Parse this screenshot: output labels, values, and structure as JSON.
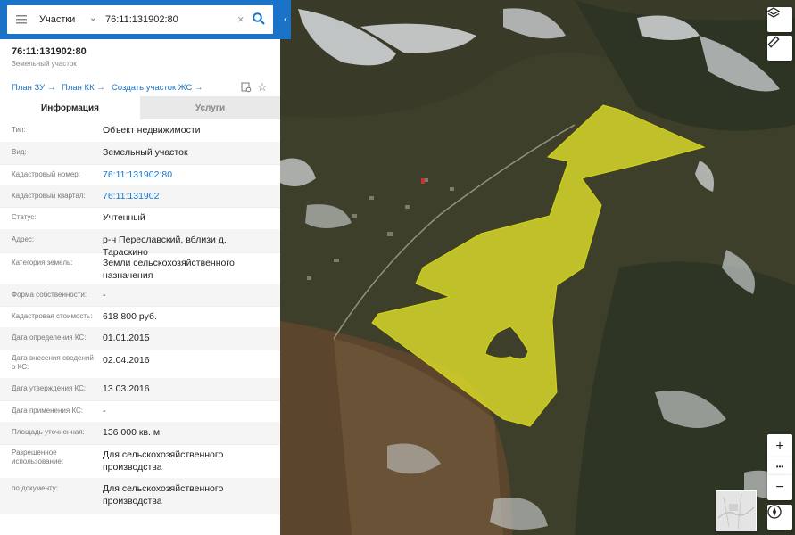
{
  "search": {
    "category": "Участки",
    "query": "76:11:131902:80"
  },
  "header": {
    "title": "76:11:131902:80",
    "subtitle": "Земельный участок"
  },
  "actions": {
    "plan_zu": "План ЗУ →",
    "plan_kk": "План КК →",
    "create": "Создать участок ЖС →"
  },
  "tabs": [
    {
      "label": "Информация",
      "active": true
    },
    {
      "label": "Услуги",
      "active": false
    }
  ],
  "info": [
    {
      "key": "Тип:",
      "value": "Объект недвижимости"
    },
    {
      "key": "Вид:",
      "value": "Земельный участок"
    },
    {
      "key": "Кадастровый номер:",
      "value": "76:11:131902:80",
      "link": true
    },
    {
      "key": "Кадастровый квартал:",
      "value": "76:11:131902",
      "link": true
    },
    {
      "key": "Статус:",
      "value": "Учтенный"
    },
    {
      "key": "Адрес:",
      "value": "р-н Переславский, вблизи д. Тараскино"
    },
    {
      "key": "Категория земель:",
      "value": "Земли сельскохозяйственного назначения"
    },
    {
      "key": "Форма собственности:",
      "value": "-"
    },
    {
      "key": "Кадастровая стоимость:",
      "value": "618 800 руб."
    },
    {
      "key": "Дата определения КС:",
      "value": "01.01.2015"
    },
    {
      "key": "Дата внесения сведений о КС:",
      "value": "02.04.2016"
    },
    {
      "key": "Дата утверждения КС:",
      "value": "13.03.2016"
    },
    {
      "key": "Дата применения КС:",
      "value": "-"
    },
    {
      "key": "Площадь уточненная:",
      "value": "136 000 кв. м"
    },
    {
      "key": "Разрешенное использование:",
      "value": "Для сельскохозяйственного производства"
    },
    {
      "key": "по документу:",
      "value": "Для сельскохозяйственного производства"
    }
  ],
  "map": {
    "parcel_color": "#e6e62a",
    "controls": [
      "layers-icon",
      "ruler-icon",
      "zoom-in",
      "more",
      "zoom-out",
      "compass-icon"
    ],
    "zoom_in": "+",
    "zoom_out": "−",
    "more": "•••"
  },
  "colors": {
    "accent": "#1a73c8"
  }
}
